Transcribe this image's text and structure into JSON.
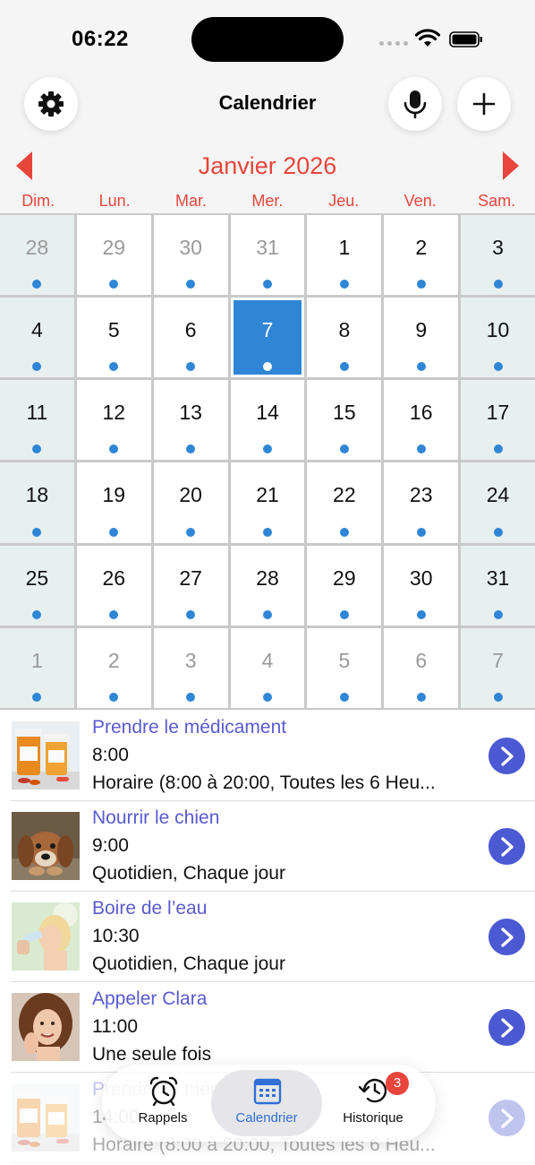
{
  "status_bar": {
    "time": "06:22"
  },
  "header": {
    "title": "Calendrier"
  },
  "calendar": {
    "month_title": "Janvier 2026",
    "weekdays": [
      "Dim.",
      "Lun.",
      "Mar.",
      "Mer.",
      "Jeu.",
      "Ven.",
      "Sam."
    ],
    "days": [
      {
        "n": "28",
        "other": true
      },
      {
        "n": "29",
        "other": true
      },
      {
        "n": "30",
        "other": true
      },
      {
        "n": "31",
        "other": true
      },
      {
        "n": "1"
      },
      {
        "n": "2"
      },
      {
        "n": "3"
      },
      {
        "n": "4"
      },
      {
        "n": "5"
      },
      {
        "n": "6"
      },
      {
        "n": "7",
        "selected": true
      },
      {
        "n": "8"
      },
      {
        "n": "9"
      },
      {
        "n": "10"
      },
      {
        "n": "11"
      },
      {
        "n": "12"
      },
      {
        "n": "13"
      },
      {
        "n": "14"
      },
      {
        "n": "15"
      },
      {
        "n": "16"
      },
      {
        "n": "17"
      },
      {
        "n": "18"
      },
      {
        "n": "19"
      },
      {
        "n": "20"
      },
      {
        "n": "21"
      },
      {
        "n": "22"
      },
      {
        "n": "23"
      },
      {
        "n": "24"
      },
      {
        "n": "25"
      },
      {
        "n": "26"
      },
      {
        "n": "27"
      },
      {
        "n": "28"
      },
      {
        "n": "29"
      },
      {
        "n": "30"
      },
      {
        "n": "31"
      },
      {
        "n": "1",
        "other": true
      },
      {
        "n": "2",
        "other": true
      },
      {
        "n": "3",
        "other": true
      },
      {
        "n": "4",
        "other": true
      },
      {
        "n": "5",
        "other": true
      },
      {
        "n": "6",
        "other": true
      },
      {
        "n": "7",
        "other": true
      }
    ]
  },
  "reminders": [
    {
      "title": "Prendre le médicament",
      "time": "8:00",
      "schedule": "Horaire (8:00 à 20:00, Toutes les 6 Heu...",
      "image": "pill-bottles"
    },
    {
      "title": "Nourrir le chien",
      "time": "9:00",
      "schedule": "Quotidien, Chaque jour",
      "image": "dog"
    },
    {
      "title": "Boire de l’eau",
      "time": "10:30",
      "schedule": "Quotidien, Chaque jour",
      "image": "woman-drinking"
    },
    {
      "title": "Appeler Clara",
      "time": "11:00",
      "schedule": "Une seule fois",
      "image": "woman-smiling"
    },
    {
      "title": "Prendre le médicament",
      "time": "14:00",
      "schedule": "Horaire (8:00 à 20:00, Toutes les 6 Heu...",
      "image": "pill-bottles"
    }
  ],
  "tabbar": {
    "rappels": "Rappels",
    "calendrier": "Calendrier",
    "historique": "Historique",
    "history_badge": "3"
  },
  "colors": {
    "accent_red": "#e8453c",
    "selected_blue": "#2f86d6",
    "title_purple": "#5a5ad0",
    "go_button": "#4b59d3"
  }
}
